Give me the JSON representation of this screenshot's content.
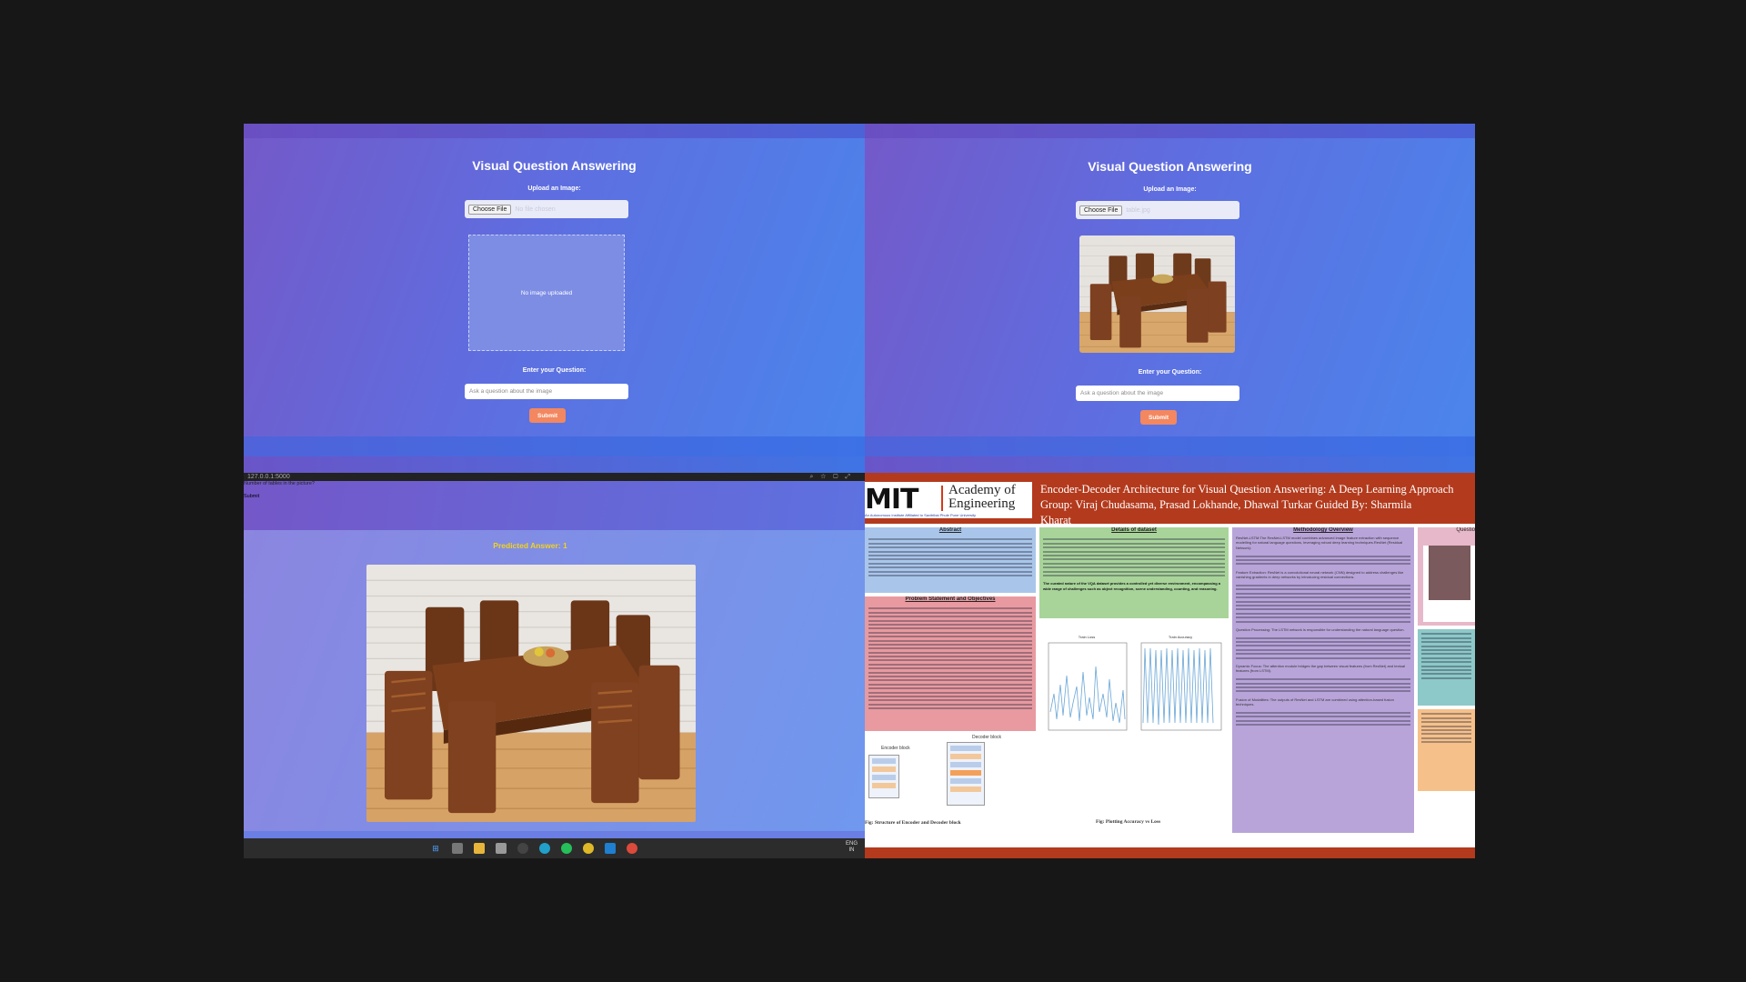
{
  "vqa_panels": [
    {
      "title": "Visual Question Answering",
      "upload_label": "Upload an Image:",
      "choose_file_label": "Choose File",
      "file_name": "No file chosen",
      "preview_text": "No image uploaded",
      "question_label": "Enter your Question:",
      "question_placeholder": "Ask a question about the image",
      "submit_label": "Submit"
    },
    {
      "title": "Visual Question Answering",
      "upload_label": "Upload an Image:",
      "choose_file_label": "Choose File",
      "file_name": "table.jpg",
      "question_label": "Enter your Question:",
      "question_placeholder": "Ask a question about the image",
      "submit_label": "Submit"
    }
  ],
  "result_panel": {
    "window_bar_text": "127.0.0.1:5000",
    "question_value": "Number of tables in the picture?",
    "submit_label": "Submit",
    "predicted_answer": "Predicted Answer: 1",
    "taskbar": {
      "lang": "ENG",
      "region": "IN"
    }
  },
  "poster": {
    "logo_main": "MIT",
    "logo_line1": "Academy of",
    "logo_line2": "Engineering",
    "logo_subtitle": "An Autonomous Institute Affiliated to Savitribai Phule Pune University",
    "title_line1": "Encoder-Decoder Architecture for Visual Question Answering: A Deep Learning Approach",
    "title_line2": "Group: Viraj Chudasama, Prasad Lokhande, Dhawal Turkar      Guided By: Sharmila",
    "title_line3": "Kharat",
    "sections": {
      "abstract": "Abstract",
      "problem": "Problem Statement and Objectives",
      "dataset": "Details of dataset",
      "methodology": "Methodology Overview",
      "question": "Questio"
    },
    "fig_caption_1": "Fig: Structure of Encoder and Decoder block",
    "fig_caption_2": "Fig: Plotting Accuracy vs Loss",
    "encoder_label": "Encoder block",
    "decoder_label": "Decoder block",
    "chart1_title": "Train Loss",
    "chart2_title": "Train Accuracy",
    "dataset_bold": "The curated nature of the VQA dataset provides a controlled yet diverse environment, encompassing a wide range of challenges such as object recognition, scene understanding, counting, and reasoning.",
    "method_items": [
      "ResNet-LSTM:The ResNet-LSTM model combines advanced image feature extraction with sequence modelling for natural language questions, leveraging robust deep learning techniques.ResNet (Residual Network):",
      "Feature Extraction: ResNet is a convolutional neural network (CNN) designed to address challenges like vanishing gradients in deep networks by introducing residual connections.",
      "Question Processing: The LSTM network is responsible for understanding the natural language question.",
      "Dynamic Focus: The attention module bridges the gap between visual features (from ResNet) and textual features (from LSTM).",
      "Fusion of Modalities: The outputs of ResNet and LSTM are combined using attention-based fusion techniques."
    ]
  }
}
